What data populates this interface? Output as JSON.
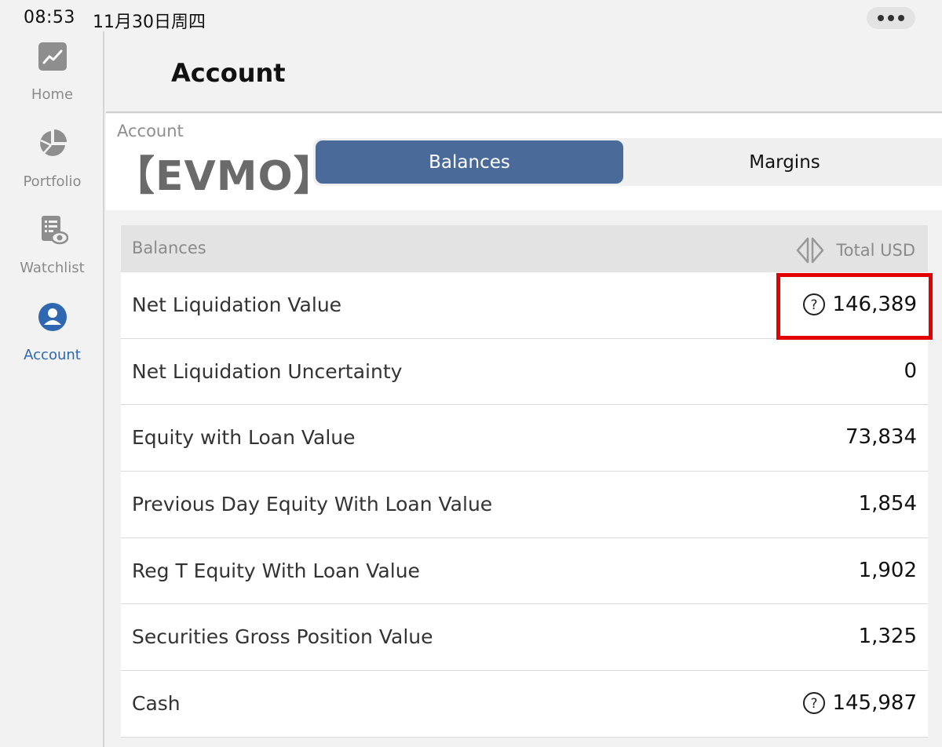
{
  "status_bar": {
    "time": "08:53",
    "date": "11月30日周四"
  },
  "header": {
    "title": "Account"
  },
  "sidebar": {
    "items": [
      {
        "label": "Home",
        "icon": "chart-up-icon",
        "active": false
      },
      {
        "label": "Portfolio",
        "icon": "pie-chart-icon",
        "active": false
      },
      {
        "label": "Watchlist",
        "icon": "list-eye-icon",
        "active": false
      },
      {
        "label": "Account",
        "icon": "user-icon",
        "active": true
      }
    ]
  },
  "account": {
    "caption": "Account",
    "code": "【EVMO】",
    "tabs": [
      {
        "label": "Balances",
        "selected": true
      },
      {
        "label": "Margins",
        "selected": false
      }
    ]
  },
  "table": {
    "header_label": "Balances",
    "currency_label": "Total USD",
    "rows": [
      {
        "label": "Net Liquidation Value",
        "value": "146,389",
        "info": true
      },
      {
        "label": "Net Liquidation Uncertainty",
        "value": "0",
        "info": false
      },
      {
        "label": "Equity with Loan Value",
        "value": "73,834",
        "info": false
      },
      {
        "label": "Previous Day Equity With Loan Value",
        "value": "1,854",
        "info": false
      },
      {
        "label": "Reg T Equity With Loan Value",
        "value": "1,902",
        "info": false
      },
      {
        "label": "Securities Gross Position Value",
        "value": "1,325",
        "info": false
      },
      {
        "label": "Cash",
        "value": "145,987",
        "info": true
      }
    ]
  },
  "colors": {
    "accent": "#2f67b1",
    "segment_selected": "#4a6b9a",
    "highlight": "#e20000"
  }
}
